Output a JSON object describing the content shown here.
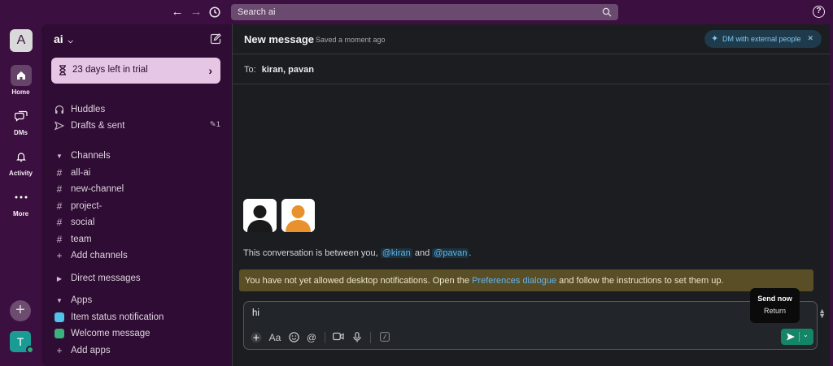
{
  "search": {
    "text": "Search ai"
  },
  "help": {
    "label": "?"
  },
  "rail": {
    "workspace_initial": "A",
    "items": [
      {
        "label": "Home"
      },
      {
        "label": "DMs"
      },
      {
        "label": "Activity"
      },
      {
        "label": "More"
      }
    ],
    "user_initial": "T"
  },
  "sidebar": {
    "workspace_name": "ai",
    "trial_text": "23 days left in trial",
    "huddles": "Huddles",
    "drafts": "Drafts & sent",
    "drafts_count": "1",
    "channels_header": "Channels",
    "channels": [
      "all-ai",
      "new-channel",
      "project-",
      "social",
      "team"
    ],
    "add_channels": "Add channels",
    "direct_messages": "Direct messages",
    "apps_header": "Apps",
    "apps": [
      {
        "label": "Item status notification",
        "color": "#4fc3e8"
      },
      {
        "label": "Welcome message",
        "color": "#3bb17b"
      }
    ],
    "add_apps": "Add apps"
  },
  "main": {
    "title": "New message",
    "saved": "Saved a moment ago",
    "external_dm": "DM with external people",
    "to_label": "To:",
    "to_names": "kiran, pavan",
    "conv_prefix": "This conversation is between you,",
    "mention_1": "@kiran",
    "conv_and": "and",
    "mention_2": "@pavan",
    "conv_suffix": ".",
    "notif_prefix": "You have not yet allowed desktop notifications. Open the",
    "notif_link": "Preferences dialogue",
    "notif_suffix": "and follow the instructions to set them up."
  },
  "composer": {
    "text": "hi",
    "tooltip_title": "Send now",
    "tooltip_shortcut": "Return"
  },
  "colors": {
    "aubergine": "#3b0f3f",
    "sidebar": "#2e0c33",
    "main_bg": "#1b1d21",
    "send_green": "#148567",
    "link_blue": "#62b4ee"
  }
}
